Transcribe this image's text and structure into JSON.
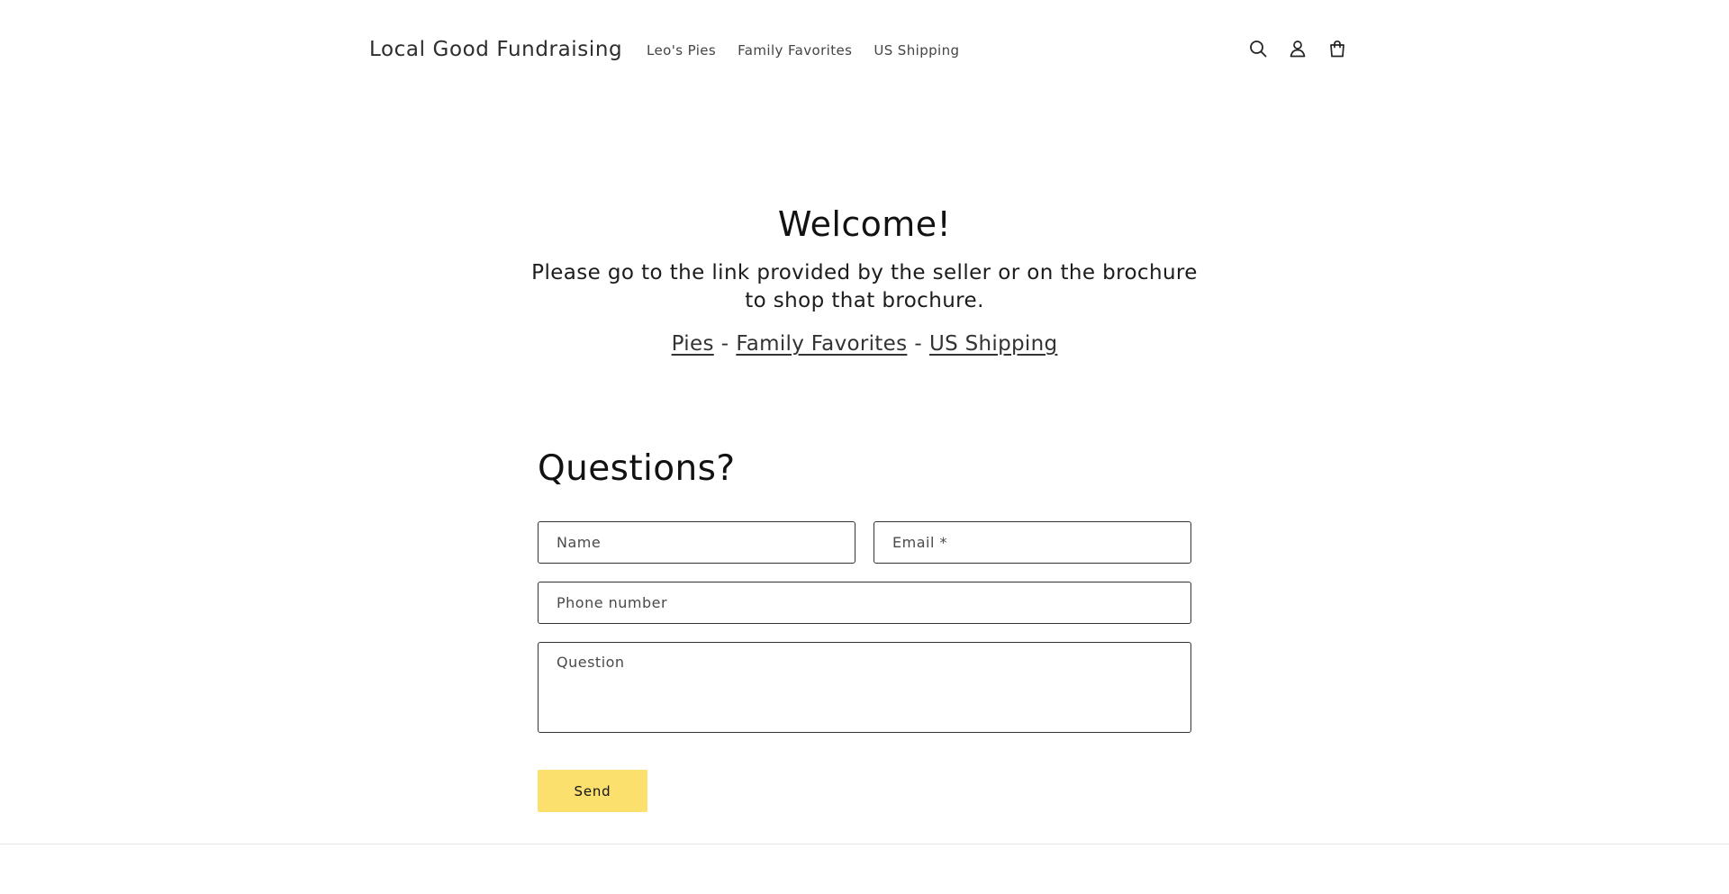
{
  "header": {
    "logo": "Local Good Fundraising",
    "nav": [
      "Leo's Pies",
      "Family Favorites",
      "US Shipping"
    ],
    "icons": [
      "search-icon",
      "account-icon",
      "cart-icon"
    ]
  },
  "welcome": {
    "title": "Welcome!",
    "subtitle": "Please go to the link provided by the seller or on the brochure to shop that brochure.",
    "links": [
      "Pies",
      "Family Favorites",
      "US Shipping"
    ],
    "separator": "-"
  },
  "contact": {
    "title": "Questions?",
    "name_placeholder": "Name",
    "email_placeholder": "Email *",
    "phone_placeholder": "Phone number",
    "question_placeholder": "Question",
    "send_label": "Send"
  },
  "colors": {
    "button": "#fbe06e",
    "text": "#121212"
  }
}
